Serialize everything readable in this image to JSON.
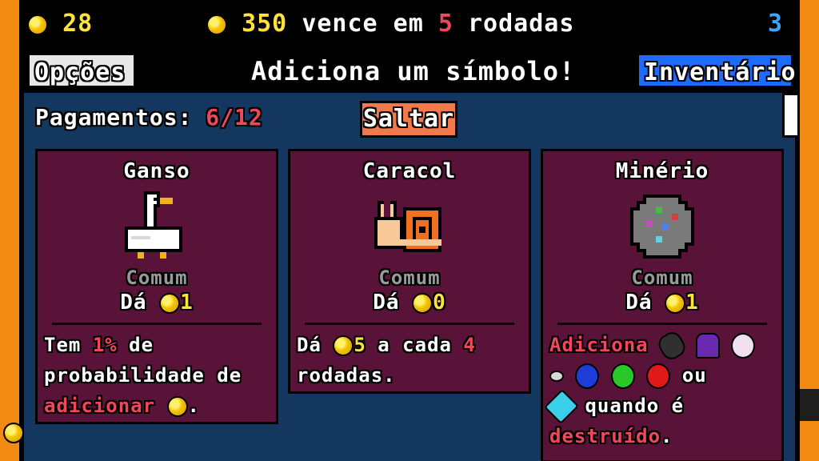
{
  "topbar": {
    "coins": "28",
    "rent_amount": "350",
    "rent_text_a": "vence em",
    "rent_spins": "5",
    "rent_text_b": "rodadas",
    "right_value": "3"
  },
  "header": {
    "options_label": "Opções",
    "title": "Adiciona um símbolo!",
    "inventory_label": "Inventário"
  },
  "panel": {
    "payments_label": "Pagamentos:",
    "payments_value": "6/12",
    "skip_label": "Saltar"
  },
  "cards": [
    {
      "name": "Ganso",
      "icon": "goose-icon",
      "rarity": "Comum",
      "gives_label": "Dá",
      "gives_value": "1",
      "desc_1": "Tem",
      "desc_pct": "1%",
      "desc_2": "de",
      "desc_3": "probabilidade de",
      "desc_action": "adicionar",
      "desc_end": "."
    },
    {
      "name": "Caracol",
      "icon": "snail-icon",
      "rarity": "Comum",
      "gives_label": "Dá",
      "gives_value": "0",
      "desc_1": "Dá",
      "desc_value": "5",
      "desc_2": "a cada",
      "desc_count": "4",
      "desc_3": "rodadas."
    },
    {
      "name": "Minério",
      "icon": "ore-icon",
      "rarity": "Comum",
      "gives_label": "Dá",
      "gives_value": "1",
      "desc_action": "Adiciona",
      "desc_or": "ou",
      "desc_when": "quando é",
      "desc_destroyed": "destruído",
      "desc_end": "."
    }
  ],
  "colors": {
    "background": "#f28a14",
    "panel": "#14375f",
    "card": "#5a1338",
    "coin_text": "#ffe23c",
    "highlight": "#f0475c",
    "inventory": "#1e6bff",
    "skip": "#f07a4e"
  }
}
